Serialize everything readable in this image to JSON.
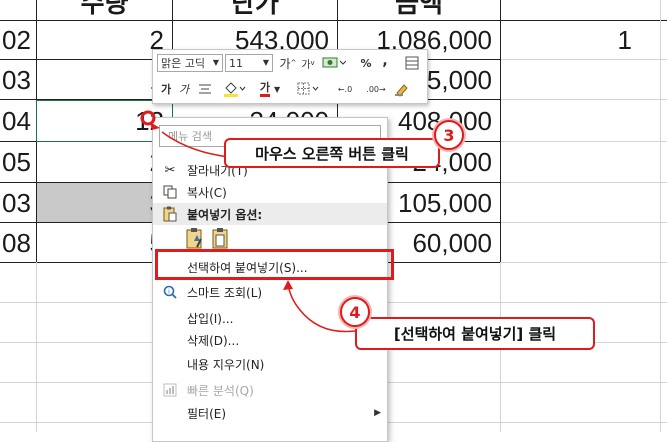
{
  "sheet": {
    "header": {
      "col_b": "수량",
      "col_c": "단가",
      "col_d": "금액"
    },
    "rows": [
      {
        "a": "02",
        "b": "2",
        "c": "543,000",
        "d": "1,086,000"
      },
      {
        "a": "03",
        "b": "1",
        "c": "",
        "d": "5,000"
      },
      {
        "a": "04",
        "b": "12",
        "c": "34,000",
        "d": "408,000"
      },
      {
        "a": "05",
        "b": "2",
        "c": "",
        "d": "24,000"
      },
      {
        "a": "03",
        "b": "3",
        "c": "",
        "d": "105,000"
      },
      {
        "a": "08",
        "b": "5",
        "c": "",
        "d": "60,000"
      }
    ],
    "side_value": "1"
  },
  "mini_toolbar": {
    "font_name": "맑은 고딕",
    "font_size": "11",
    "grow": "가",
    "shrink": "가",
    "percent": "%",
    "comma": ",",
    "bold": "가",
    "italic": "가",
    "font_color_label": "가",
    "inc_decimal": "←.0",
    "dec_decimal": ".00→"
  },
  "context_menu": {
    "search_placeholder": "메뉴 검색",
    "items": {
      "cut": "잘라내기(T)",
      "copy": "복사(C)",
      "paste_options": "붙여넣기 옵션:",
      "paste_special": "선택하여 붙여넣기(S)...",
      "smart_lookup": "스마트 조회(L)",
      "insert": "삽입(I)...",
      "delete": "삭제(D)...",
      "clear": "내용 지우기(N)",
      "quick_analysis": "빠른 분석(Q)",
      "filter": "필터(E)"
    }
  },
  "annotations": {
    "step3_badge": "3",
    "step3_text": "마우스 오른쪽 버튼 클릭",
    "step4_badge": "4",
    "step4_text": "[선택하여 붙여넣기] 클릭",
    "accent": "#e01b1b"
  }
}
